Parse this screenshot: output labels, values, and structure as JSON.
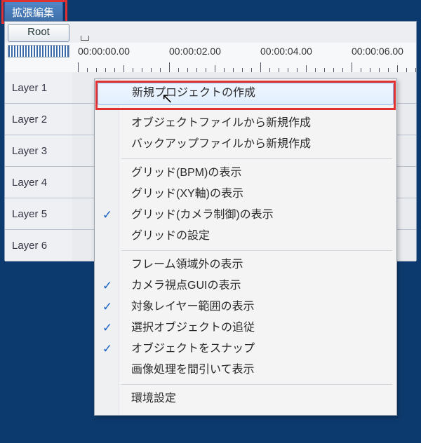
{
  "title": "拡張編集",
  "root_label": "Root",
  "timecodes": [
    "00:00:00.00",
    "00:00:02.00",
    "00:00:04.00",
    "00:00:06.00"
  ],
  "layers": [
    "Layer 1",
    "Layer 2",
    "Layer 3",
    "Layer 4",
    "Layer 5",
    "Layer 6"
  ],
  "menu": {
    "groups": [
      [
        {
          "label": "新規プロジェクトの作成",
          "checked": false,
          "hover": true
        }
      ],
      [
        {
          "label": "オブジェクトファイルから新規作成",
          "checked": false
        },
        {
          "label": "バックアップファイルから新規作成",
          "checked": false
        }
      ],
      [
        {
          "label": "グリッド(BPM)の表示",
          "checked": false
        },
        {
          "label": "グリッド(XY軸)の表示",
          "checked": false
        },
        {
          "label": "グリッド(カメラ制御)の表示",
          "checked": true
        },
        {
          "label": "グリッドの設定",
          "checked": false
        }
      ],
      [
        {
          "label": "フレーム領域外の表示",
          "checked": false
        },
        {
          "label": "カメラ視点GUIの表示",
          "checked": true
        },
        {
          "label": "対象レイヤー範囲の表示",
          "checked": true
        },
        {
          "label": "選択オブジェクトの追従",
          "checked": true
        },
        {
          "label": "オブジェクトをスナップ",
          "checked": true
        },
        {
          "label": "画像処理を間引いて表示",
          "checked": false
        }
      ],
      [
        {
          "label": "環境設定",
          "checked": false
        }
      ]
    ]
  },
  "colors": {
    "highlight_border": "#e03030",
    "menu_hover_bg": "#e6f1ff",
    "desktop_bg": "#0d3a6e"
  }
}
